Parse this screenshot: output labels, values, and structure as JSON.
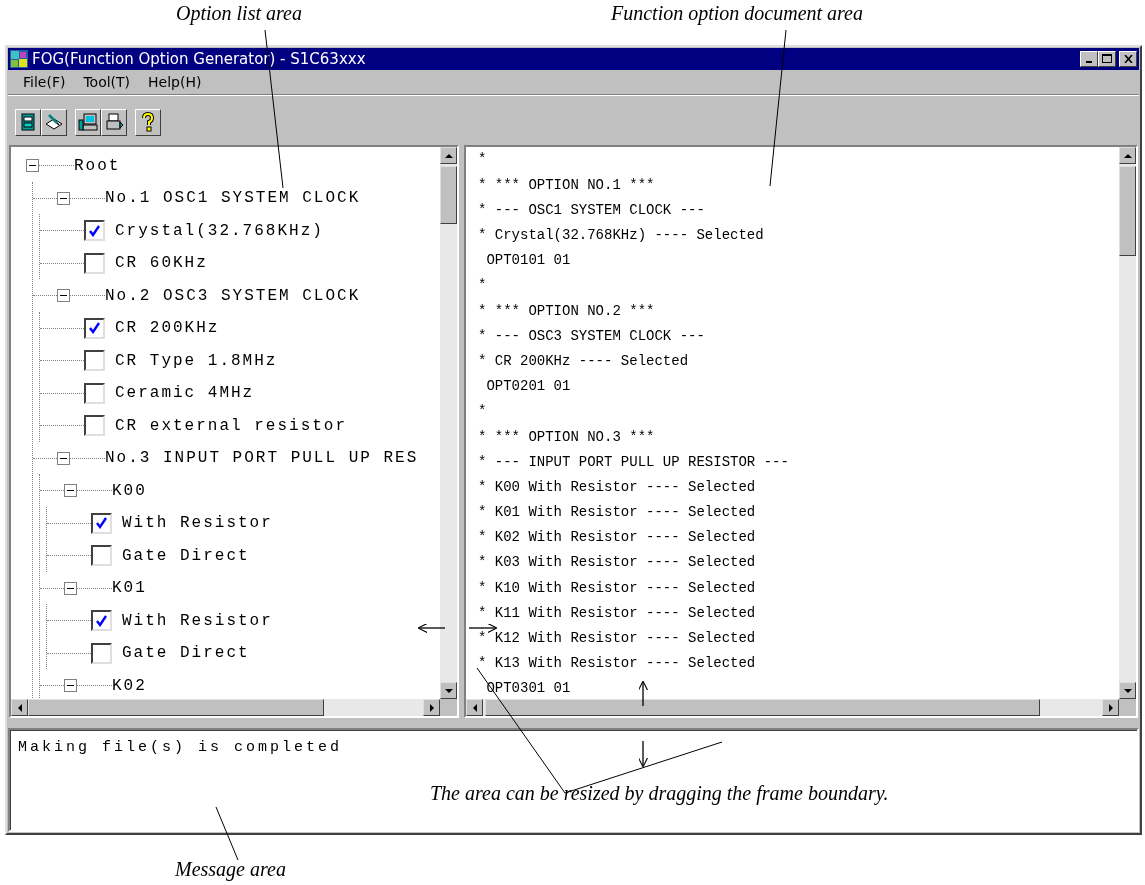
{
  "annotations": {
    "option_list": "Option list area",
    "document": "Function option document area",
    "resize": "The area can be resized by dragging the frame boundary.",
    "message": "Message area"
  },
  "window": {
    "title": "FOG(Function Option Generator) - S1C63xxx"
  },
  "menu": [
    "File(F)",
    "Tool(T)",
    "Help(H)"
  ],
  "option_tree": {
    "kind": "group",
    "label": "Root",
    "expanded": true,
    "children": [
      {
        "kind": "group",
        "label": "No.1 OSC1 SYSTEM CLOCK",
        "expanded": true,
        "children": [
          {
            "kind": "option",
            "label": "Crystal(32.768KHz)",
            "checked": true
          },
          {
            "kind": "option",
            "label": "CR 60KHz",
            "checked": false
          }
        ]
      },
      {
        "kind": "group",
        "label": "No.2 OSC3 SYSTEM CLOCK",
        "expanded": true,
        "children": [
          {
            "kind": "option",
            "label": "CR 200KHz",
            "checked": true
          },
          {
            "kind": "option",
            "label": "CR Type 1.8MHz",
            "checked": false
          },
          {
            "kind": "option",
            "label": "Ceramic 4MHz",
            "checked": false
          },
          {
            "kind": "option",
            "label": "CR external resistor",
            "checked": false
          }
        ]
      },
      {
        "kind": "group",
        "label": "No.3 INPUT PORT PULL UP RES",
        "expanded": true,
        "children": [
          {
            "kind": "group",
            "label": "K00",
            "expanded": true,
            "children": [
              {
                "kind": "option",
                "label": "With Resistor",
                "checked": true
              },
              {
                "kind": "option",
                "label": "Gate Direct",
                "checked": false
              }
            ]
          },
          {
            "kind": "group",
            "label": "K01",
            "expanded": true,
            "children": [
              {
                "kind": "option",
                "label": "With Resistor",
                "checked": true
              },
              {
                "kind": "option",
                "label": "Gate Direct",
                "checked": false
              }
            ]
          },
          {
            "kind": "group",
            "label": "K02",
            "expanded": true
          }
        ]
      }
    ]
  },
  "document_lines": [
    "*",
    "* *** OPTION NO.1 ***",
    "* --- OSC1 SYSTEM CLOCK ---",
    "* Crystal(32.768KHz) ---- Selected",
    " OPT0101 01",
    "*",
    "* *** OPTION NO.2 ***",
    "* --- OSC3 SYSTEM CLOCK ---",
    "* CR 200KHz ---- Selected",
    " OPT0201 01",
    "*",
    "* *** OPTION NO.3 ***",
    "* --- INPUT PORT PULL UP RESISTOR ---",
    "* K00 With Resistor ---- Selected",
    "* K01 With Resistor ---- Selected",
    "* K02 With Resistor ---- Selected",
    "* K03 With Resistor ---- Selected",
    "* K10 With Resistor ---- Selected",
    "* K11 With Resistor ---- Selected",
    "* K12 With Resistor ---- Selected",
    "* K13 With Resistor ---- Selected",
    " OPT0301 01"
  ],
  "message": "Making file(s) is completed"
}
